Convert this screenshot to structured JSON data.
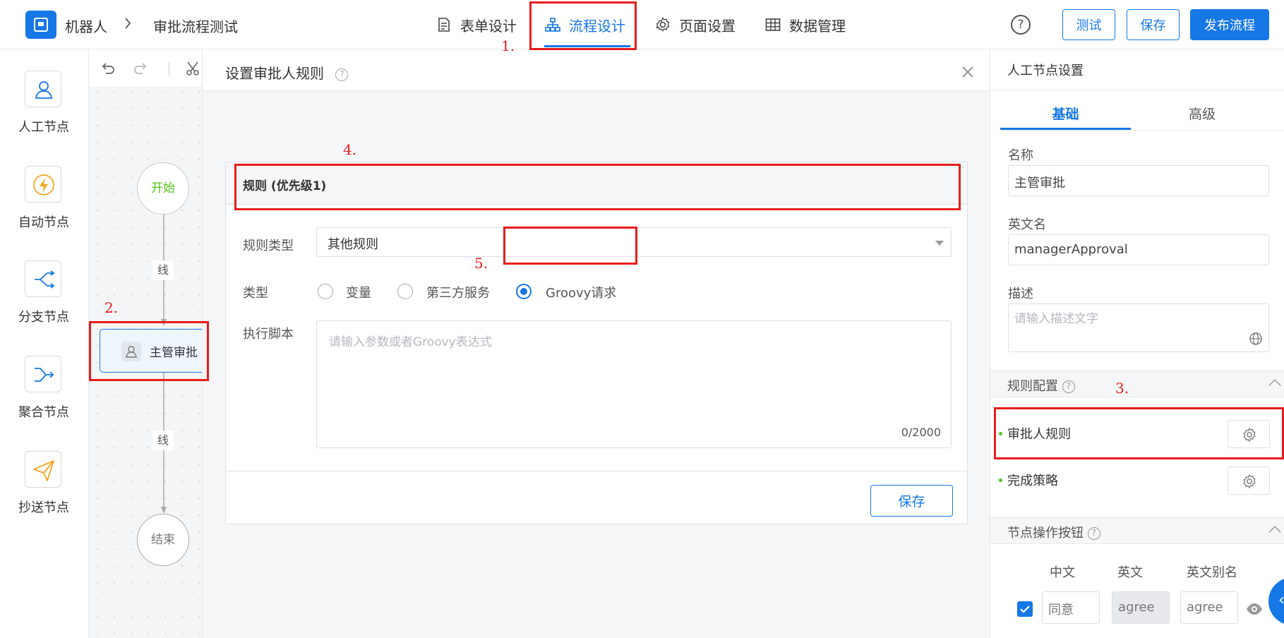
{
  "header": {
    "breadcrumb_app": "机器人",
    "breadcrumb_page": "审批流程测试",
    "tabs": [
      {
        "label": "表单设计",
        "icon": "document-icon"
      },
      {
        "label": "流程设计",
        "icon": "flow-chart-icon"
      },
      {
        "label": "页面设置",
        "icon": "gear-icon"
      },
      {
        "label": "数据管理",
        "icon": "table-icon"
      }
    ],
    "active_tab": "流程设计",
    "help": "?",
    "test_label": "测试",
    "save_label": "保存",
    "publish_label": "发布流程",
    "accent": "#1677e6"
  },
  "palette": {
    "items": [
      {
        "label": "人工节点",
        "icon": "user-icon"
      },
      {
        "label": "自动节点",
        "icon": "lightning-icon"
      },
      {
        "label": "分支节点",
        "icon": "branch-icon"
      },
      {
        "label": "聚合节点",
        "icon": "merge-icon"
      },
      {
        "label": "抄送节点",
        "icon": "send-icon"
      }
    ]
  },
  "canvas": {
    "start_label": "开始",
    "line1_label": "线",
    "node_label": "主管审批",
    "line2_label": "线",
    "end_label": "结束"
  },
  "modal": {
    "title": "设置审批人规则",
    "card_title": "规则 (优先级1)",
    "rule_type_label": "规则类型",
    "rule_type_value": "其他规则",
    "type_label": "类型",
    "radio_options": [
      "变量",
      "第三方服务",
      "Groovy请求"
    ],
    "selected_radio": "Groovy请求",
    "script_label": "执行脚本",
    "script_placeholder": "请输入参数或者Groovy表达式",
    "char_count": "0/2000",
    "save_label": "保存"
  },
  "right_panel": {
    "title": "人工节点设置",
    "tabs": [
      "基础",
      "高级"
    ],
    "active_tab": "基础",
    "name_label": "名称",
    "name_value": "主管审批",
    "en_name_label": "英文名",
    "en_name_value": "managerApproval",
    "desc_label": "描述",
    "desc_placeholder": "请输入描述文字",
    "rule_section_title": "规则配置",
    "approver_rule_label": "审批人规则",
    "complete_strategy_label": "完成策略",
    "buttons_section_title": "节点操作按钮",
    "col_cn": "中文",
    "col_en": "英文",
    "col_alias": "英文别名",
    "row_cn": "同意",
    "row_en": "agree",
    "row_alias": "agree"
  },
  "annotations": [
    "1.",
    "2.",
    "3.",
    "4.",
    "5."
  ]
}
